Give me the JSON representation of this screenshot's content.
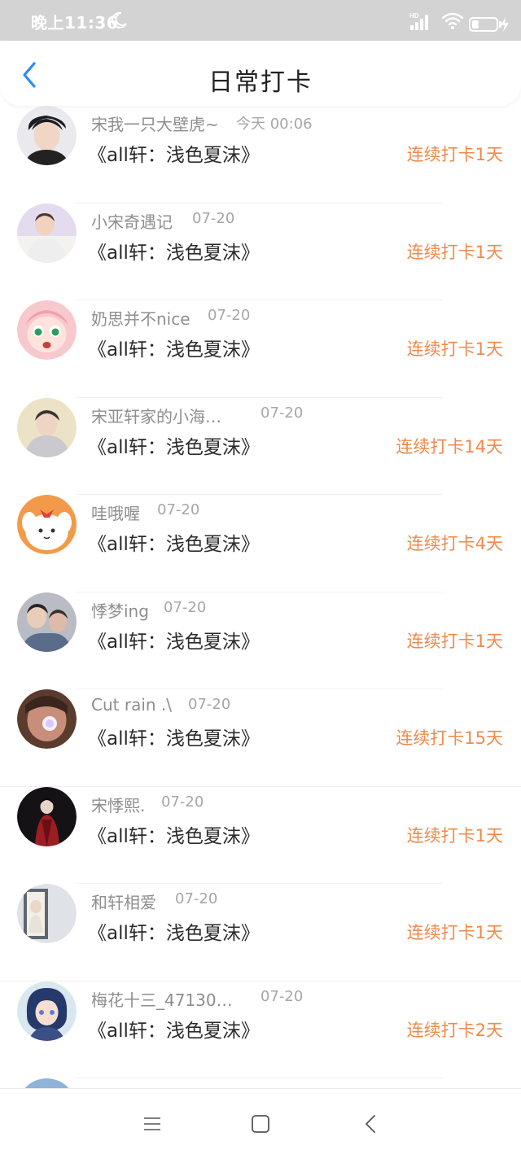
{
  "status_bar": {
    "time": "晚上11:36",
    "battery_level": "28",
    "battery_fraction": 0.28
  },
  "header": {
    "title": "日常打卡"
  },
  "list": [
    {
      "name": "宋我一只大壁虎~",
      "time": "今天 00:06",
      "title": "《all轩：浅色夏沫》",
      "streak": "连续打卡1天"
    },
    {
      "name": "小宋奇遇记",
      "time": "07-20",
      "title": "《all轩：浅色夏沫》",
      "streak": "连续打卡1天"
    },
    {
      "name": "奶思并不nice",
      "time": "07-20",
      "title": "《all轩：浅色夏沫》",
      "streak": "连续打卡1天"
    },
    {
      "name": "宋亚轩家的小海…",
      "time": "07-20",
      "title": "《all轩：浅色夏沫》",
      "streak": "连续打卡14天"
    },
    {
      "name": "哇哦喔",
      "time": "07-20",
      "title": "《all轩：浅色夏沫》",
      "streak": "连续打卡4天"
    },
    {
      "name": "悸梦ing",
      "time": "07-20",
      "title": "《all轩：浅色夏沫》",
      "streak": "连续打卡1天"
    },
    {
      "name": "Cut rain .\\",
      "time": "07-20",
      "title": "《all轩：浅色夏沫》",
      "streak": "连续打卡15天"
    },
    {
      "name": "宋悸熙.",
      "time": "07-20",
      "title": "《all轩：浅色夏沫》",
      "streak": "连续打卡1天"
    },
    {
      "name": "和轩相爱",
      "time": "07-20",
      "title": "《all轩：浅色夏沫》",
      "streak": "连续打卡1天"
    },
    {
      "name": "梅花十三_47130…",
      "time": "07-20",
      "title": "《all轩：浅色夏沫》",
      "streak": "连续打卡2天"
    }
  ],
  "colors": {
    "streak": "#ef8a4c",
    "back_arrow": "#2a8df7",
    "status_bar_bg": "#d3d3d3"
  },
  "icons": {
    "back": "chevron-left-icon",
    "moon": "moon-icon",
    "signal": "signal-icon",
    "wifi": "wifi-icon",
    "battery": "battery-icon",
    "charging": "lightning-icon",
    "nav_menu": "menu-icon",
    "nav_home": "square-icon",
    "nav_back": "chevron-left-icon"
  }
}
